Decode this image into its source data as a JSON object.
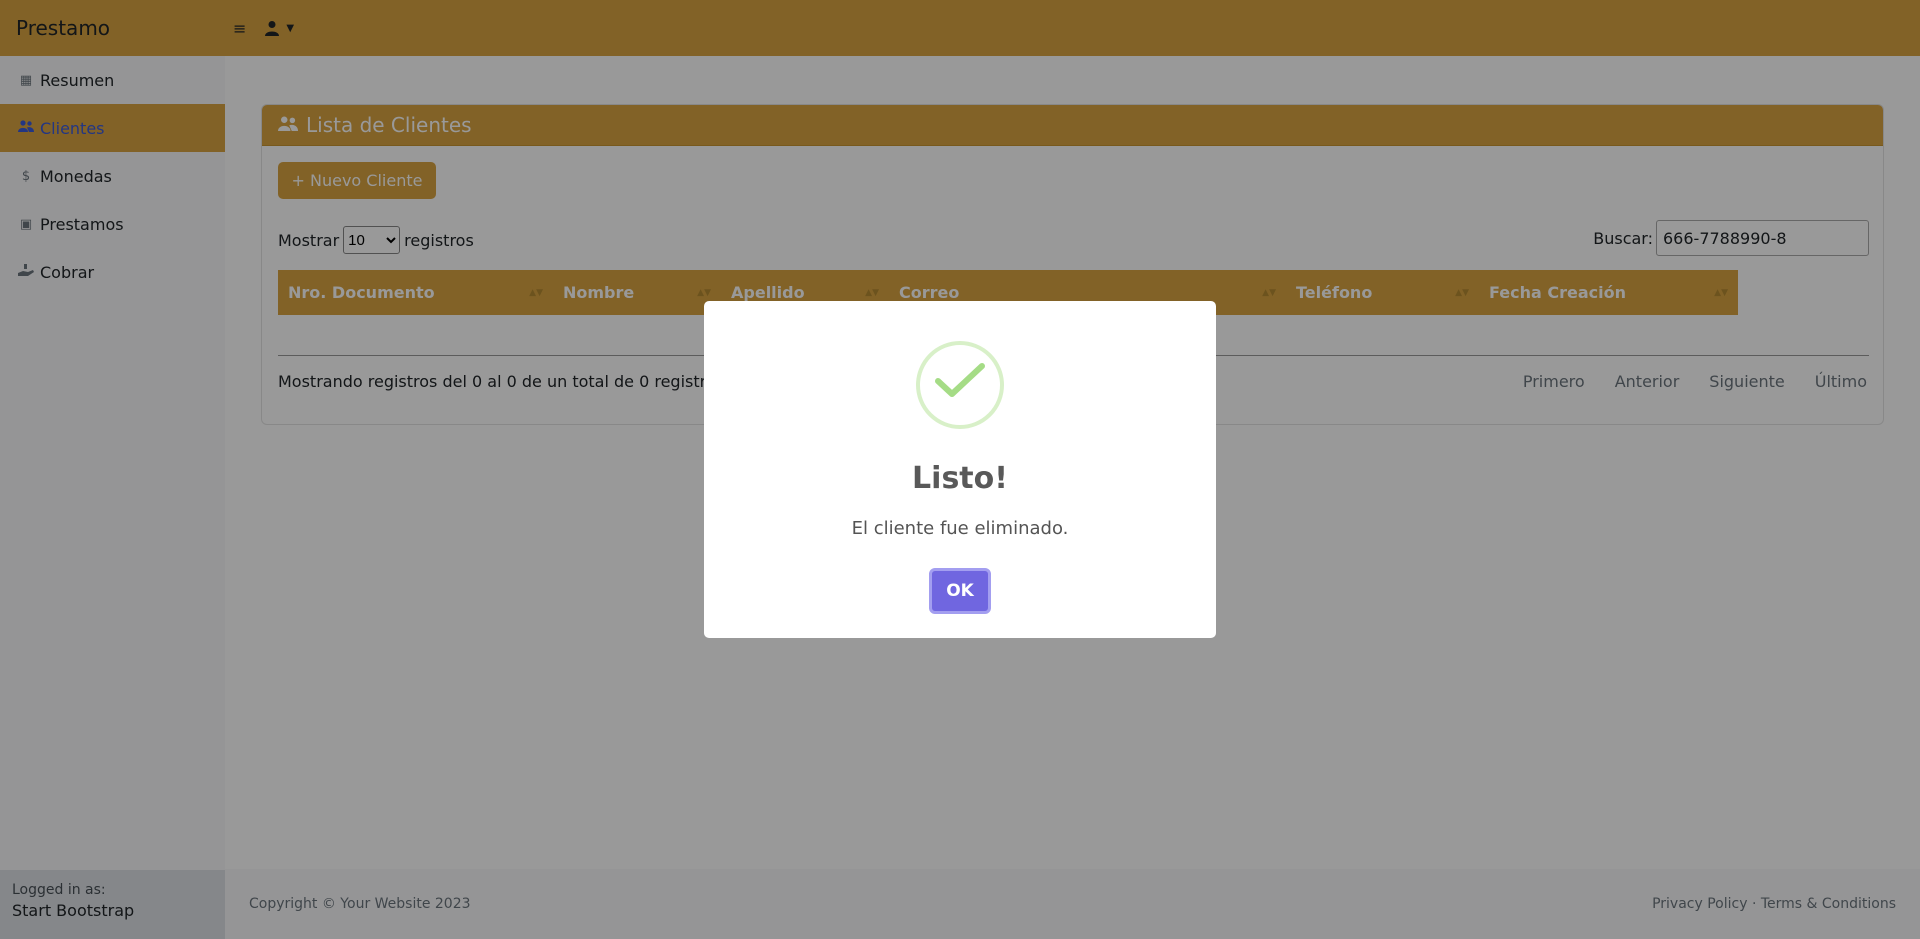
{
  "app": {
    "brand": "Prestamo",
    "toggle_icon": "≡"
  },
  "sidebar": {
    "items": [
      {
        "label": "Resumen",
        "icon": "table-icon"
      },
      {
        "label": "Clientes",
        "icon": "users-icon",
        "active": true
      },
      {
        "label": "Monedas",
        "icon": "dollar-icon"
      },
      {
        "label": "Prestamos",
        "icon": "money-bill-icon"
      },
      {
        "label": "Cobrar",
        "icon": "hand-holding-icon"
      }
    ],
    "footer": {
      "logged_label": "Logged in as:",
      "user": "Start Bootstrap"
    }
  },
  "card": {
    "title": "Lista de Clientes",
    "new_button": "+ Nuevo Cliente",
    "show_label": "Mostrar",
    "page_length": "10",
    "records_label": "registros",
    "search_label": "Buscar:",
    "search_value": "666-7788990-8",
    "columns": [
      "Nro. Documento",
      "Nombre",
      "Apellido",
      "Correo",
      "Teléfono",
      "Fecha Creación"
    ],
    "info": "Mostrando registros del 0 al 0 de un total de 0 registros",
    "pager": [
      "Primero",
      "Anterior",
      "Siguiente",
      "Último"
    ]
  },
  "footer": {
    "copyright": "Copyright © Your Website 2023",
    "links": "Privacy Policy · Terms & Conditions"
  },
  "modal": {
    "title": "Listo!",
    "text": "El cliente fue eliminado.",
    "ok": "OK",
    "icon": "success-check-icon"
  },
  "colors": {
    "accent": "#d9a441",
    "ok_button": "#7066e0",
    "success": "#a5dc86"
  }
}
